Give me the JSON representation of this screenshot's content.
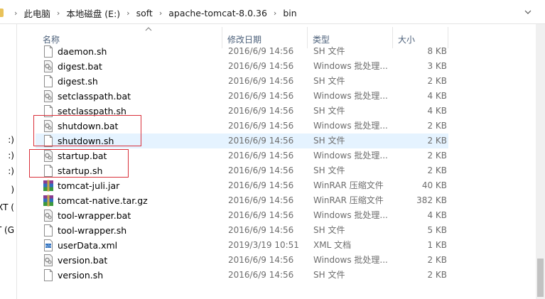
{
  "address_bar": {
    "breadcrumbs": [
      "此电脑",
      "本地磁盘 (E:)",
      "soft",
      "apache-tomcat-8.0.36",
      "bin"
    ]
  },
  "nav": {
    "items": [
      ":)",
      ":)",
      ":)",
      ")",
      "XT (",
      "T (G"
    ]
  },
  "columns": {
    "name": "名称",
    "date": "修改日期",
    "type": "类型",
    "size": "大小"
  },
  "files": [
    {
      "name": "daemon.sh",
      "date": "2016/6/9 14:56",
      "type": "SH 文件",
      "size": "8 KB",
      "icon": "sh-file-icon"
    },
    {
      "name": "digest.bat",
      "date": "2016/6/9 14:56",
      "type": "Windows 批处理...",
      "size": "3 KB",
      "icon": "bat-file-icon"
    },
    {
      "name": "digest.sh",
      "date": "2016/6/9 14:56",
      "type": "SH 文件",
      "size": "2 KB",
      "icon": "sh-file-icon"
    },
    {
      "name": "setclasspath.bat",
      "date": "2016/6/9 14:56",
      "type": "Windows 批处理...",
      "size": "4 KB",
      "icon": "bat-file-icon"
    },
    {
      "name": "setclasspath.sh",
      "date": "2016/6/9 14:56",
      "type": "SH 文件",
      "size": "4 KB",
      "icon": "sh-file-icon"
    },
    {
      "name": "shutdown.bat",
      "date": "2016/6/9 14:56",
      "type": "Windows 批处理...",
      "size": "2 KB",
      "icon": "bat-file-icon"
    },
    {
      "name": "shutdown.sh",
      "date": "2016/6/9 14:56",
      "type": "SH 文件",
      "size": "2 KB",
      "icon": "sh-file-icon"
    },
    {
      "name": "startup.bat",
      "date": "2016/6/9 14:56",
      "type": "Windows 批处理...",
      "size": "2 KB",
      "icon": "bat-file-icon"
    },
    {
      "name": "startup.sh",
      "date": "2016/6/9 14:56",
      "type": "SH 文件",
      "size": "2 KB",
      "icon": "sh-file-icon"
    },
    {
      "name": "tomcat-juli.jar",
      "date": "2016/6/9 14:56",
      "type": "WinRAR 压缩文件",
      "size": "40 KB",
      "icon": "winrar-archive-icon"
    },
    {
      "name": "tomcat-native.tar.gz",
      "date": "2016/6/9 14:56",
      "type": "WinRAR 压缩文件",
      "size": "382 KB",
      "icon": "winrar-archive-icon"
    },
    {
      "name": "tool-wrapper.bat",
      "date": "2016/6/9 14:56",
      "type": "Windows 批处理...",
      "size": "4 KB",
      "icon": "bat-file-icon"
    },
    {
      "name": "tool-wrapper.sh",
      "date": "2016/6/9 14:56",
      "type": "SH 文件",
      "size": "5 KB",
      "icon": "sh-file-icon"
    },
    {
      "name": "userData.xml",
      "date": "2019/3/19 10:51",
      "type": "XML 文档",
      "size": "1 KB",
      "icon": "xml-file-icon"
    },
    {
      "name": "version.bat",
      "date": "2016/6/9 14:56",
      "type": "Windows 批处理...",
      "size": "2 KB",
      "icon": "bat-file-icon"
    },
    {
      "name": "version.sh",
      "date": "2016/6/9 14:56",
      "type": "SH 文件",
      "size": "2 KB",
      "icon": "sh-file-icon"
    }
  ],
  "colors": {
    "hover_row": "#e5f3ff",
    "annotation_red": "#d9303a",
    "header_text": "#4c607a"
  }
}
